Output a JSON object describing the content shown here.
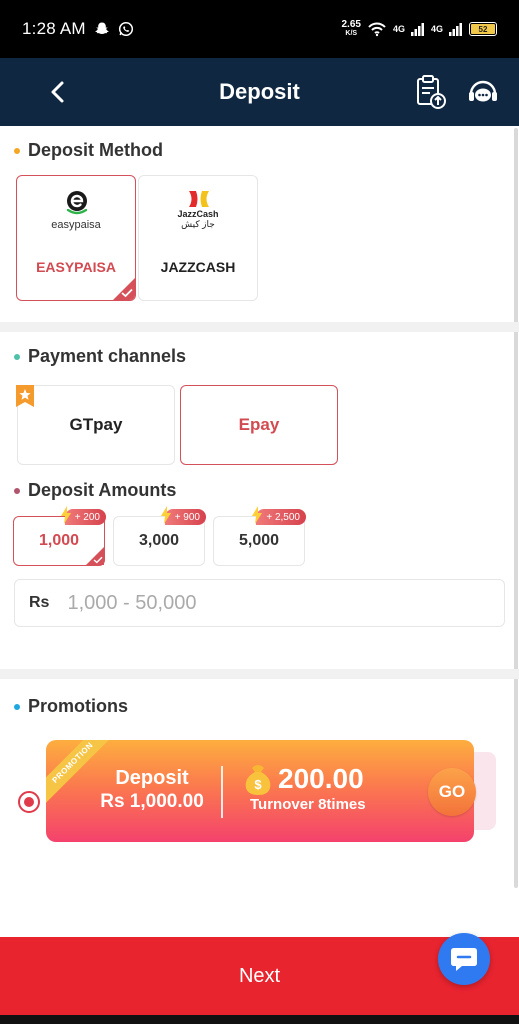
{
  "status_bar": {
    "time": "1:28 AM",
    "speed_value": "2.65",
    "speed_unit": "K/S",
    "network_1": "4G",
    "network_2": "4G",
    "battery": "52",
    "icons": [
      "snapchat-icon",
      "whatsapp-icon",
      "wifi-icon",
      "signal-icon",
      "signal-icon",
      "battery-icon"
    ]
  },
  "header": {
    "title": "Deposit",
    "back_icon": "back-arrow-icon",
    "records_icon": "deposit-records-icon",
    "support_icon": "customer-service-icon"
  },
  "deposit_method": {
    "title": "Deposit Method",
    "dot_color": "#f5a623",
    "methods": [
      {
        "label": "EASYPAISA",
        "logo_text": "easypaisa",
        "selected": true
      },
      {
        "label": "JAZZCASH",
        "logo_text": "JazzCash",
        "logo_subtext": "جاز کیش",
        "selected": false
      }
    ]
  },
  "payment_channels": {
    "title": "Payment channels",
    "dot_color": "#4fc1a8",
    "channels": [
      {
        "label": "GTpay",
        "selected": false,
        "badge_icon": "recommended-badge-icon"
      },
      {
        "label": "Epay",
        "selected": true
      }
    ]
  },
  "deposit_amounts": {
    "title": "Deposit Amounts",
    "dot_color": "#b0556b",
    "options": [
      {
        "value": "1,000",
        "bonus": "+ 200",
        "selected": true
      },
      {
        "value": "3,000",
        "bonus": "+ 900",
        "selected": false
      },
      {
        "value": "5,000",
        "bonus": "+ 2,500",
        "selected": false
      }
    ],
    "input": {
      "currency": "Rs",
      "placeholder": "1,000 - 50,000",
      "value": ""
    }
  },
  "promotions": {
    "title": "Promotions",
    "dot_color": "#1fa8e0",
    "items": [
      {
        "ribbon": "PROMOTION",
        "line1": "Deposit",
        "line2": "Rs 1,000.00",
        "bonus_amount": "200.00",
        "turnover": "Turnover 8times",
        "go_label": "GO",
        "selected": true
      }
    ]
  },
  "footer": {
    "next_label": "Next",
    "chat_icon": "chat-bubble-icon"
  },
  "colors": {
    "header_bg": "#0f2740",
    "accent_red": "#d6505a",
    "next_button": "#e8242f",
    "chat_fab": "#2f7af0"
  }
}
